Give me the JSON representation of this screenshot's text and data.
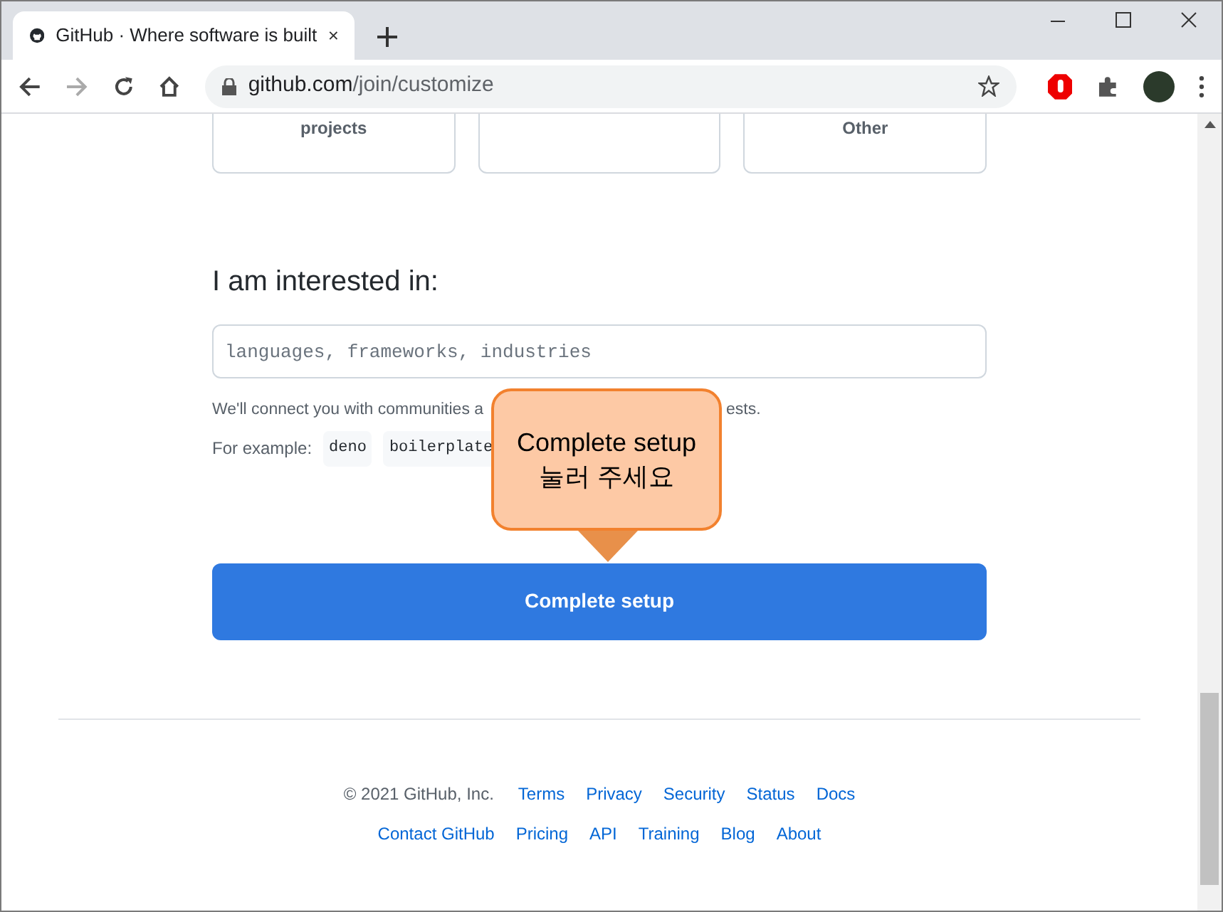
{
  "browser": {
    "tab_title": "GitHub · Where software is built",
    "url_host": "github.com",
    "url_path": "/join/customize"
  },
  "cards": [
    {
      "kind": "labeled",
      "label": "projects"
    },
    {
      "kind": "blank"
    },
    {
      "kind": "labeled",
      "label": "Other"
    }
  ],
  "interests": {
    "heading": "I am interested in:",
    "placeholder": "languages, frameworks, industries",
    "note_before": "We'll connect you with communities a",
    "note_after": "ests.",
    "example_label": "For example:",
    "examples": [
      "deno",
      "boilerplate"
    ]
  },
  "callout": {
    "lines": [
      "Complete setup",
      "눌러 주세요"
    ]
  },
  "submit": "Complete setup",
  "footer": {
    "copyright": "© 2021 GitHub, Inc.",
    "row1": [
      "Terms",
      "Privacy",
      "Security",
      "Status",
      "Docs"
    ],
    "row2": [
      "Contact GitHub",
      "Pricing",
      "API",
      "Training",
      "Blog",
      "About"
    ]
  }
}
